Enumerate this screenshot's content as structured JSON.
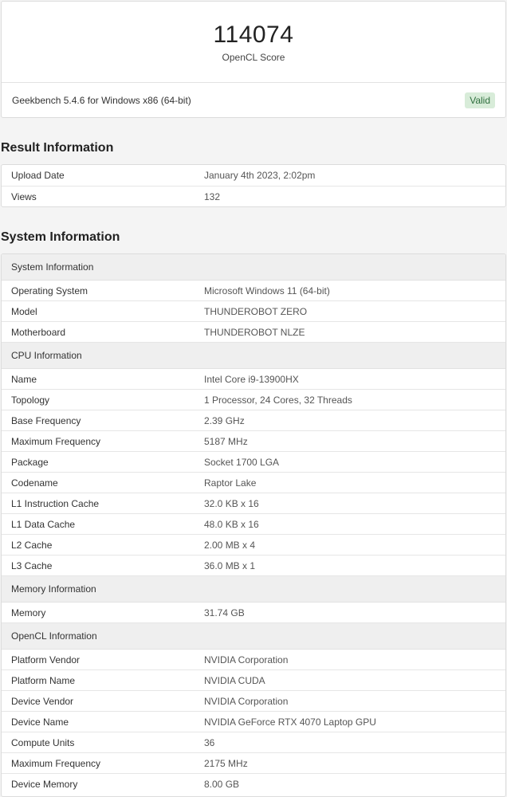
{
  "score": {
    "value": "114074",
    "label": "OpenCL Score",
    "version": "Geekbench 5.4.6 for Windows x86 (64-bit)",
    "status": "Valid"
  },
  "result": {
    "heading": "Result Information",
    "rows": [
      {
        "key": "Upload Date",
        "value": "January 4th 2023, 2:02pm"
      },
      {
        "key": "Views",
        "value": "132"
      }
    ]
  },
  "system": {
    "heading": "System Information",
    "sections": [
      {
        "title": "System Information",
        "rows": [
          {
            "key": "Operating System",
            "value": "Microsoft Windows 11 (64-bit)"
          },
          {
            "key": "Model",
            "value": "THUNDEROBOT ZERO"
          },
          {
            "key": "Motherboard",
            "value": "THUNDEROBOT NLZE"
          }
        ]
      },
      {
        "title": "CPU Information",
        "rows": [
          {
            "key": "Name",
            "value": "Intel Core i9-13900HX"
          },
          {
            "key": "Topology",
            "value": "1 Processor, 24 Cores, 32 Threads"
          },
          {
            "key": "Base Frequency",
            "value": "2.39 GHz"
          },
          {
            "key": "Maximum Frequency",
            "value": "5187 MHz"
          },
          {
            "key": "Package",
            "value": "Socket 1700 LGA"
          },
          {
            "key": "Codename",
            "value": "Raptor Lake"
          },
          {
            "key": "L1 Instruction Cache",
            "value": "32.0 KB x 16"
          },
          {
            "key": "L1 Data Cache",
            "value": "48.0 KB x 16"
          },
          {
            "key": "L2 Cache",
            "value": "2.00 MB x 4"
          },
          {
            "key": "L3 Cache",
            "value": "36.0 MB x 1"
          }
        ]
      },
      {
        "title": "Memory Information",
        "rows": [
          {
            "key": "Memory",
            "value": "31.74 GB"
          }
        ]
      },
      {
        "title": "OpenCL Information",
        "rows": [
          {
            "key": "Platform Vendor",
            "value": "NVIDIA Corporation"
          },
          {
            "key": "Platform Name",
            "value": "NVIDIA CUDA"
          },
          {
            "key": "Device Vendor",
            "value": "NVIDIA Corporation"
          },
          {
            "key": "Device Name",
            "value": "NVIDIA GeForce RTX 4070 Laptop GPU"
          },
          {
            "key": "Compute Units",
            "value": "36"
          },
          {
            "key": "Maximum Frequency",
            "value": "2175 MHz"
          },
          {
            "key": "Device Memory",
            "value": "8.00 GB"
          }
        ]
      }
    ]
  }
}
